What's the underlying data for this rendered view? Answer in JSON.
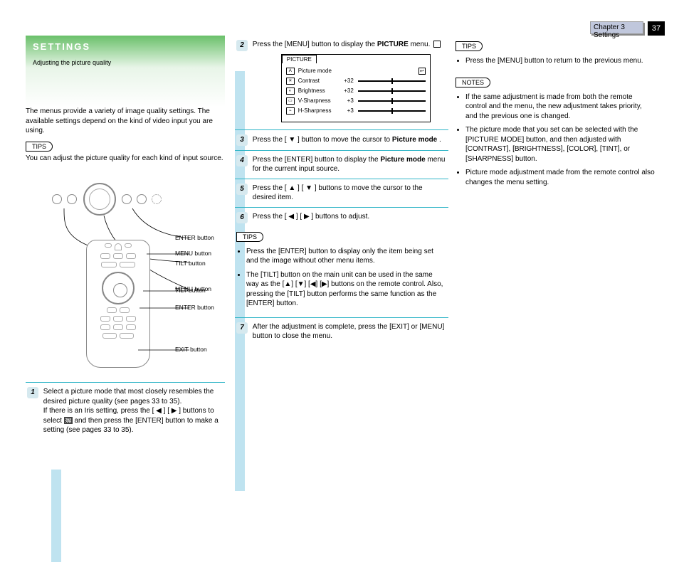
{
  "chapter": {
    "label": "Chapter 3 Settings",
    "page_num": "37"
  },
  "header": {
    "title_line1": "SETTINGS",
    "title_line2": "Adjusting the picture quality"
  },
  "left": {
    "intro": "The menus provide a variety of image quality settings. The available settings depend on the kind of video input you are using.",
    "tip1": {
      "label": "TIPS",
      "body": "You can adjust the picture quality for each kind of input source."
    },
    "diagram": {
      "panel_label_menu": "MENU button",
      "panel_label_tilt": "TILT button",
      "panel_label_enter": "ENTER button",
      "rc_label_menu": "MENU button",
      "rc_label_tilt": "TILT button",
      "rc_label_enter": "ENTER button",
      "rc_label_exit": "EXIT button"
    },
    "steps": {
      "s1": {
        "num": "1",
        "text_a": "Select a picture mode that most closely resembles the desired picture quality (see pages 33 to 35).",
        "text_b": "If there is an Iris setting, press the [ ◀ ] [ ▶ ] buttons to select ",
        "text_c": " and then press the [ENTER] button to make a setting (see pages 33 to 35).",
        "iris_alt": "Iris"
      }
    }
  },
  "mid": {
    "s2": {
      "num": "2",
      "text": "Press the [MENU] button to display the ",
      "text_em": "PICTURE",
      "text_after": " menu.",
      "osd": {
        "tab": "PICTURE",
        "rows": [
          {
            "icon": "A",
            "label": "Picture mode",
            "value": "",
            "glyph": "↩"
          },
          {
            "icon": "☀",
            "label": "Contrast",
            "value": "+32"
          },
          {
            "icon": "◐",
            "label": "Brightness",
            "value": "+32"
          },
          {
            "icon": "▭",
            "label": "V-Sharpness",
            "value": "+3"
          },
          {
            "icon": "⌁",
            "label": "H-Sharpness",
            "value": "+3"
          }
        ]
      }
    },
    "s3": {
      "num": "3",
      "text_a": "Press the [ ▼ ] button to move the cursor to ",
      "text_em": "Picture mode",
      "text_b": "."
    },
    "s4": {
      "num": "4",
      "text_a": "Press the [ENTER] button to display the ",
      "text_em": "Picture mode",
      "text_b": " menu for the current input source."
    },
    "s5": {
      "num": "5",
      "text": "Press the [ ▲ ] [ ▼ ] buttons to move the cursor to the desired item."
    },
    "s6": {
      "num": "6",
      "text": "Press the [ ◀ ] [ ▶ ] buttons to adjust."
    },
    "tip2": {
      "label": "TIPS",
      "items": [
        "Press the [ENTER] button to display only the item being set and the image without other menu items.",
        "The [TILT] button on the main unit can be used in the same way as the [▲] [▼] [◀] [▶] buttons on the remote control. Also, pressing the [TILT] button performs the same function as the [ENTER] button."
      ]
    },
    "s7": {
      "num": "7",
      "text": "After the adjustment is complete, press the [EXIT] or [MENU] button to close the menu."
    }
  },
  "right": {
    "tip3": {
      "label": "TIPS",
      "items": [
        "Press the [MENU] button to return to the previous menu."
      ]
    },
    "notes": {
      "label": "NOTES",
      "items": [
        "If the same adjustment is made from both the remote control and the menu, the new adjustment takes priority, and the previous one is changed.",
        "The picture mode that you set can be selected with the [PICTURE MODE] button, and then adjusted with [CONTRAST], [BRIGHTNESS], [COLOR], [TINT], or [SHARPNESS] button.",
        "Picture mode adjustment made from the remote control also changes the menu setting."
      ]
    }
  }
}
